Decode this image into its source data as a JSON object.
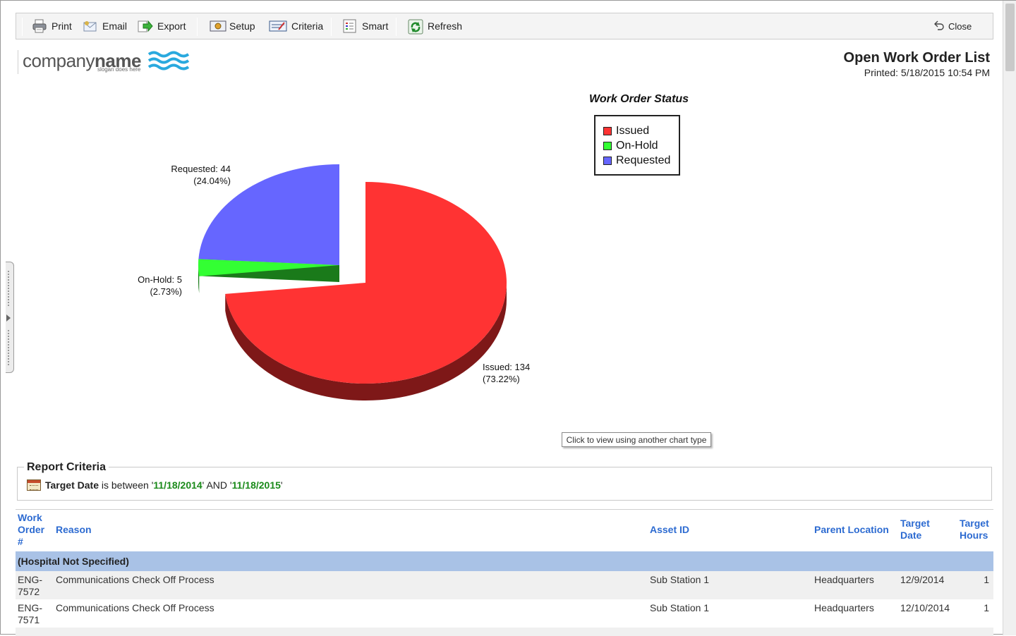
{
  "toolbar": {
    "print": "Print",
    "email": "Email",
    "export": "Export",
    "setup": "Setup",
    "criteria": "Criteria",
    "smart": "Smart",
    "refresh": "Refresh",
    "close": "Close"
  },
  "logo": {
    "company_prefix": "company",
    "company_bold": "name",
    "slogan": "slogan does here"
  },
  "report": {
    "title": "Open Work Order List",
    "printed": "Printed: 5/18/2015  10:54 PM"
  },
  "chart_data": {
    "type": "pie",
    "title": "Work Order Status",
    "legend_position": "top-right",
    "categories": [
      "Issued",
      "On-Hold",
      "Requested"
    ],
    "values": [
      134,
      5,
      44
    ],
    "percents": [
      "73.22%",
      "2.73%",
      "24.04%"
    ],
    "labels": [
      {
        "line1": "Issued: 134",
        "line2": "(73.22%)"
      },
      {
        "line1": "On-Hold: 5",
        "line2": "(2.73%)"
      },
      {
        "line1": "Requested: 44",
        "line2": "(24.04%)"
      }
    ],
    "colors": [
      "#ff3333",
      "#33ff33",
      "#6666ff"
    ],
    "side_colors": [
      "#7e1818",
      "#1a7a1a",
      "#33337a"
    ]
  },
  "chart_type_button": "Click to view using another chart type",
  "criteria": {
    "title": "Report Criteria",
    "field": "Target Date",
    "text_mid": " is between '",
    "date_from": "11/18/2014",
    "text_and": "' AND '",
    "date_to": "11/18/2015",
    "text_end": "'"
  },
  "table": {
    "headers": {
      "wo": "Work Order #",
      "reason": "Reason",
      "asset": "Asset ID",
      "parent": "Parent Location",
      "target_date": "Target Date",
      "target_hours": "Target Hours"
    },
    "group": "(Hospital Not Specified)",
    "rows": [
      {
        "wo": "ENG-7572",
        "reason": "Communications Check Off Process",
        "asset": "Sub Station 1",
        "parent": "Headquarters",
        "target_date": "12/9/2014",
        "hours": "1"
      },
      {
        "wo": "ENG-7571",
        "reason": "Communications Check Off Process",
        "asset": "Sub Station 1",
        "parent": "Headquarters",
        "target_date": "12/10/2014",
        "hours": "1"
      }
    ]
  },
  "colors": {
    "header_link": "#2d6bd1",
    "group_row": "#a9c2e6",
    "criteria_value": "#1a8a1a"
  }
}
